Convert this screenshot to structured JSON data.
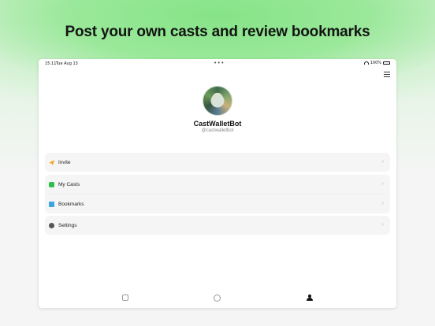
{
  "headline": "Post your own casts and review bookmarks",
  "status_bar": {
    "time": "15:11",
    "date": "Tue Aug 13",
    "dots": "•••",
    "battery": "100%"
  },
  "profile": {
    "display_name": "CastWalletBot",
    "username": "@castwalletbot"
  },
  "menu": {
    "invite": "Invite",
    "my_casts": "My Casts",
    "bookmarks": "Bookmarks",
    "settings": "Settings",
    "chevron": "›"
  },
  "icons": {
    "invite": "paper-plane-icon",
    "my_casts": "casts-icon",
    "bookmarks": "bookmark-icon",
    "settings": "gear-icon",
    "menu": "hamburger-icon"
  },
  "colors": {
    "accent_green": "#8ee38d",
    "invite_icon": "#f2a81d",
    "casts_icon": "#2fbf4a",
    "bookmarks_icon": "#3aa4e0"
  }
}
